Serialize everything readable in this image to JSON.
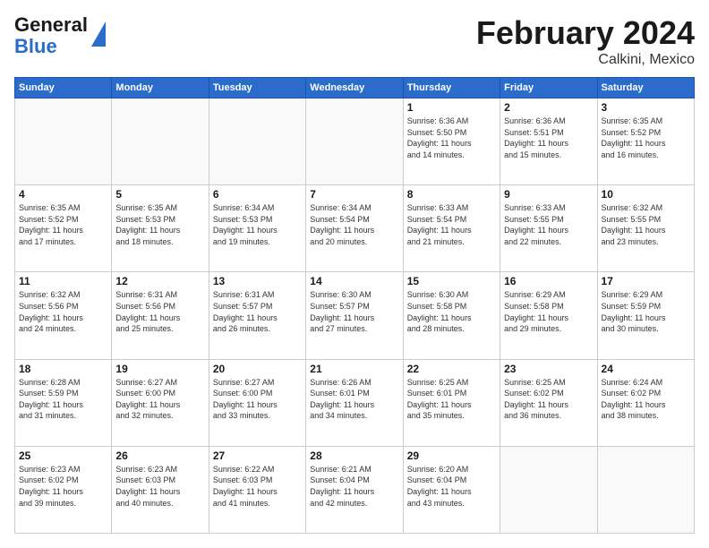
{
  "header": {
    "logo_general": "General",
    "logo_blue": "Blue",
    "title": "February 2024",
    "subtitle": "Calkini, Mexico"
  },
  "weekdays": [
    "Sunday",
    "Monday",
    "Tuesday",
    "Wednesday",
    "Thursday",
    "Friday",
    "Saturday"
  ],
  "weeks": [
    [
      {
        "day": "",
        "info": ""
      },
      {
        "day": "",
        "info": ""
      },
      {
        "day": "",
        "info": ""
      },
      {
        "day": "",
        "info": ""
      },
      {
        "day": "1",
        "info": "Sunrise: 6:36 AM\nSunset: 5:50 PM\nDaylight: 11 hours\nand 14 minutes."
      },
      {
        "day": "2",
        "info": "Sunrise: 6:36 AM\nSunset: 5:51 PM\nDaylight: 11 hours\nand 15 minutes."
      },
      {
        "day": "3",
        "info": "Sunrise: 6:35 AM\nSunset: 5:52 PM\nDaylight: 11 hours\nand 16 minutes."
      }
    ],
    [
      {
        "day": "4",
        "info": "Sunrise: 6:35 AM\nSunset: 5:52 PM\nDaylight: 11 hours\nand 17 minutes."
      },
      {
        "day": "5",
        "info": "Sunrise: 6:35 AM\nSunset: 5:53 PM\nDaylight: 11 hours\nand 18 minutes."
      },
      {
        "day": "6",
        "info": "Sunrise: 6:34 AM\nSunset: 5:53 PM\nDaylight: 11 hours\nand 19 minutes."
      },
      {
        "day": "7",
        "info": "Sunrise: 6:34 AM\nSunset: 5:54 PM\nDaylight: 11 hours\nand 20 minutes."
      },
      {
        "day": "8",
        "info": "Sunrise: 6:33 AM\nSunset: 5:54 PM\nDaylight: 11 hours\nand 21 minutes."
      },
      {
        "day": "9",
        "info": "Sunrise: 6:33 AM\nSunset: 5:55 PM\nDaylight: 11 hours\nand 22 minutes."
      },
      {
        "day": "10",
        "info": "Sunrise: 6:32 AM\nSunset: 5:55 PM\nDaylight: 11 hours\nand 23 minutes."
      }
    ],
    [
      {
        "day": "11",
        "info": "Sunrise: 6:32 AM\nSunset: 5:56 PM\nDaylight: 11 hours\nand 24 minutes."
      },
      {
        "day": "12",
        "info": "Sunrise: 6:31 AM\nSunset: 5:56 PM\nDaylight: 11 hours\nand 25 minutes."
      },
      {
        "day": "13",
        "info": "Sunrise: 6:31 AM\nSunset: 5:57 PM\nDaylight: 11 hours\nand 26 minutes."
      },
      {
        "day": "14",
        "info": "Sunrise: 6:30 AM\nSunset: 5:57 PM\nDaylight: 11 hours\nand 27 minutes."
      },
      {
        "day": "15",
        "info": "Sunrise: 6:30 AM\nSunset: 5:58 PM\nDaylight: 11 hours\nand 28 minutes."
      },
      {
        "day": "16",
        "info": "Sunrise: 6:29 AM\nSunset: 5:58 PM\nDaylight: 11 hours\nand 29 minutes."
      },
      {
        "day": "17",
        "info": "Sunrise: 6:29 AM\nSunset: 5:59 PM\nDaylight: 11 hours\nand 30 minutes."
      }
    ],
    [
      {
        "day": "18",
        "info": "Sunrise: 6:28 AM\nSunset: 5:59 PM\nDaylight: 11 hours\nand 31 minutes."
      },
      {
        "day": "19",
        "info": "Sunrise: 6:27 AM\nSunset: 6:00 PM\nDaylight: 11 hours\nand 32 minutes."
      },
      {
        "day": "20",
        "info": "Sunrise: 6:27 AM\nSunset: 6:00 PM\nDaylight: 11 hours\nand 33 minutes."
      },
      {
        "day": "21",
        "info": "Sunrise: 6:26 AM\nSunset: 6:01 PM\nDaylight: 11 hours\nand 34 minutes."
      },
      {
        "day": "22",
        "info": "Sunrise: 6:25 AM\nSunset: 6:01 PM\nDaylight: 11 hours\nand 35 minutes."
      },
      {
        "day": "23",
        "info": "Sunrise: 6:25 AM\nSunset: 6:02 PM\nDaylight: 11 hours\nand 36 minutes."
      },
      {
        "day": "24",
        "info": "Sunrise: 6:24 AM\nSunset: 6:02 PM\nDaylight: 11 hours\nand 38 minutes."
      }
    ],
    [
      {
        "day": "25",
        "info": "Sunrise: 6:23 AM\nSunset: 6:02 PM\nDaylight: 11 hours\nand 39 minutes."
      },
      {
        "day": "26",
        "info": "Sunrise: 6:23 AM\nSunset: 6:03 PM\nDaylight: 11 hours\nand 40 minutes."
      },
      {
        "day": "27",
        "info": "Sunrise: 6:22 AM\nSunset: 6:03 PM\nDaylight: 11 hours\nand 41 minutes."
      },
      {
        "day": "28",
        "info": "Sunrise: 6:21 AM\nSunset: 6:04 PM\nDaylight: 11 hours\nand 42 minutes."
      },
      {
        "day": "29",
        "info": "Sunrise: 6:20 AM\nSunset: 6:04 PM\nDaylight: 11 hours\nand 43 minutes."
      },
      {
        "day": "",
        "info": ""
      },
      {
        "day": "",
        "info": ""
      }
    ]
  ]
}
